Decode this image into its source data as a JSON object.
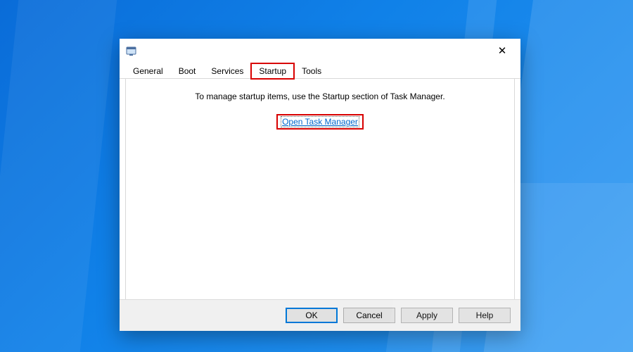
{
  "tabs": {
    "general": "General",
    "boot": "Boot",
    "services": "Services",
    "startup": "Startup",
    "tools": "Tools",
    "active": "startup"
  },
  "content": {
    "message": "To manage startup items, use the Startup section of Task Manager.",
    "link": "Open Task Manager"
  },
  "buttons": {
    "ok": "OK",
    "cancel": "Cancel",
    "apply": "Apply",
    "help": "Help"
  },
  "titlebar": {
    "close_glyph": "✕"
  }
}
